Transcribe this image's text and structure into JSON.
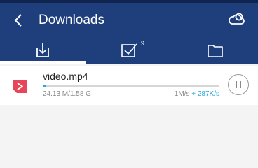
{
  "header": {
    "title": "Downloads",
    "back_icon": "chevron-left-icon",
    "cloud_icon": "cloud-icon"
  },
  "tabs": [
    {
      "name": "downloading",
      "icon": "download-icon",
      "active": true
    },
    {
      "name": "completed",
      "icon": "checked-box-icon",
      "badge": "9"
    },
    {
      "name": "folder",
      "icon": "folder-icon"
    }
  ],
  "downloads": [
    {
      "filename": "video.mp4",
      "size": "24.13 M/1.58 G",
      "speed": "1M/s",
      "speed_delta": "+ 287K/s",
      "progress": 0.015,
      "icon": "video-file-icon",
      "action_icon": "pause-icon"
    }
  ],
  "colors": {
    "app_bar": "#1f3f7c",
    "accent": "#2ba8e0",
    "file_icon": "#e8445a"
  }
}
